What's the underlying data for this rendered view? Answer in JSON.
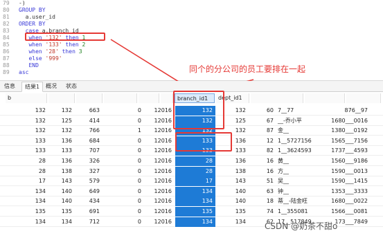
{
  "editor": {
    "lines": [
      {
        "num": "79",
        "parts": [
          {
            "t": "-)",
            "c": "txt"
          }
        ]
      },
      {
        "num": "80",
        "parts": [
          {
            "t": "GROUP BY",
            "c": "kw"
          }
        ]
      },
      {
        "num": "81",
        "parts": [
          {
            "t": "  a.user_id",
            "c": "txt"
          }
        ]
      },
      {
        "num": "82",
        "parts": [
          {
            "t": "ORDER BY",
            "c": "kw"
          }
        ]
      },
      {
        "num": "83",
        "parts": [
          {
            "t": "  case ",
            "c": "kw"
          },
          {
            "t": "a.branch_id",
            "c": "txt"
          }
        ]
      },
      {
        "num": "84",
        "parts": [
          {
            "t": "   when ",
            "c": "kw"
          },
          {
            "t": "'132'",
            "c": "str"
          },
          {
            "t": " then ",
            "c": "kw"
          },
          {
            "t": "1",
            "c": "num"
          }
        ]
      },
      {
        "num": "85",
        "parts": [
          {
            "t": "   when ",
            "c": "kw"
          },
          {
            "t": "'133'",
            "c": "str"
          },
          {
            "t": " then ",
            "c": "kw"
          },
          {
            "t": "2",
            "c": "num"
          }
        ]
      },
      {
        "num": "86",
        "parts": [
          {
            "t": "   when ",
            "c": "kw"
          },
          {
            "t": "'28'",
            "c": "str"
          },
          {
            "t": " then ",
            "c": "kw"
          },
          {
            "t": "3",
            "c": "num"
          }
        ]
      },
      {
        "num": "87",
        "parts": [
          {
            "t": "   else ",
            "c": "kw"
          },
          {
            "t": "'999'",
            "c": "str"
          }
        ]
      },
      {
        "num": "88",
        "parts": [
          {
            "t": "   END",
            "c": "kw"
          }
        ]
      },
      {
        "num": "89",
        "parts": [
          {
            "t": "asc",
            "c": "kw"
          }
        ]
      }
    ]
  },
  "annotation": "同个的分公司的员工要排在一起",
  "tabs": [
    "信息",
    "结果1",
    "概况",
    "状态"
  ],
  "active_tab": 1,
  "grid": {
    "headers": [
      "b",
      "",
      "",
      "",
      "",
      "",
      "branch_id1",
      "dept_id1",
      "",
      "",
      ""
    ],
    "rows": [
      [
        "132",
        "132",
        "663",
        "0",
        "12016",
        "132",
        "132",
        "60",
        "7__77",
        "876__97"
      ],
      [
        "132",
        "125",
        "414",
        "0",
        "12016",
        "132",
        "125",
        "67",
        "__-乔小平",
        "1680___0016"
      ],
      [
        "132",
        "132",
        "766",
        "1",
        "12016",
        "132",
        "132",
        "87",
        "金__",
        "1380___0192"
      ],
      [
        "133",
        "136",
        "684",
        "0",
        "12016",
        "133",
        "136",
        "12",
        "1__5727156",
        "1565___7156"
      ],
      [
        "133",
        "133",
        "707",
        "0",
        "12016",
        "133",
        "133",
        "82",
        "1__3624593",
        "1737___4593"
      ],
      [
        "28",
        "136",
        "326",
        "0",
        "12016",
        "28",
        "136",
        "16",
        "黄__",
        "1560___9186"
      ],
      [
        "28",
        "138",
        "327",
        "0",
        "12016",
        "28",
        "138",
        "16",
        "方__",
        "1590___0013"
      ],
      [
        "17",
        "143",
        "579",
        "0",
        "12016",
        "17",
        "143",
        "51",
        "吴__",
        "1590___1415"
      ],
      [
        "134",
        "140",
        "649",
        "0",
        "12016",
        "134",
        "140",
        "63",
        "钟__",
        "1353___3333"
      ],
      [
        "134",
        "140",
        "434",
        "0",
        "12016",
        "134",
        "140",
        "18",
        "蒂__-陆金旺",
        "1680___0022"
      ],
      [
        "135",
        "135",
        "691",
        "0",
        "12016",
        "135",
        "135",
        "74",
        "1__355081",
        "1566___0081"
      ],
      [
        "134",
        "134",
        "712",
        "0",
        "12016",
        "134",
        "134",
        "62",
        "17__517849",
        "173___7849"
      ]
    ]
  },
  "watermark": "CSDN @奶茶不甜o",
  "colors": {
    "accent": "#1e7bd6",
    "annotation": "#e53935"
  }
}
